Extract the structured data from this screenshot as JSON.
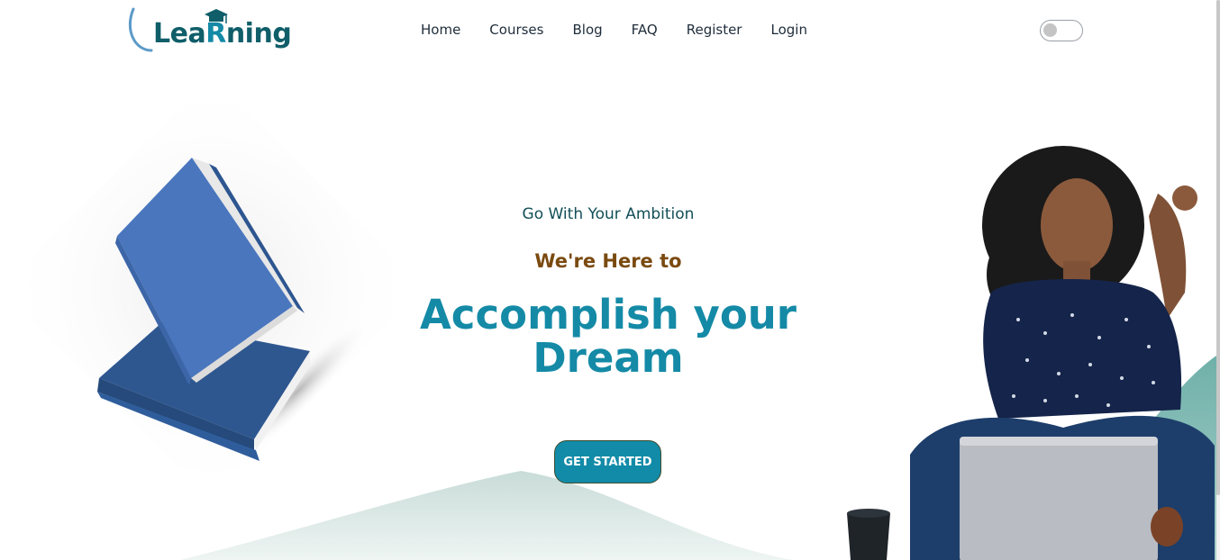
{
  "brand": {
    "name": "LeaRning",
    "primary_color": "#0f5e69",
    "accent_color": "#148aa6",
    "cap_icon": "graduation-cap-icon"
  },
  "nav": {
    "items": [
      {
        "label": "Home"
      },
      {
        "label": "Courses"
      },
      {
        "label": "Blog"
      },
      {
        "label": "FAQ"
      },
      {
        "label": "Register"
      },
      {
        "label": "Login"
      }
    ],
    "theme_toggle": {
      "state": "off"
    }
  },
  "hero": {
    "tagline": "Go With Your Ambition",
    "subtitle": "We're Here to",
    "headline": "Accomplish your Dream",
    "cta_label": "GET STARTED",
    "headline_color": "#148aa6",
    "subtitle_color": "#7a4a10"
  },
  "illustrations": {
    "left": "blue-books-illustration",
    "right": "woman-with-laptop-illustration"
  }
}
